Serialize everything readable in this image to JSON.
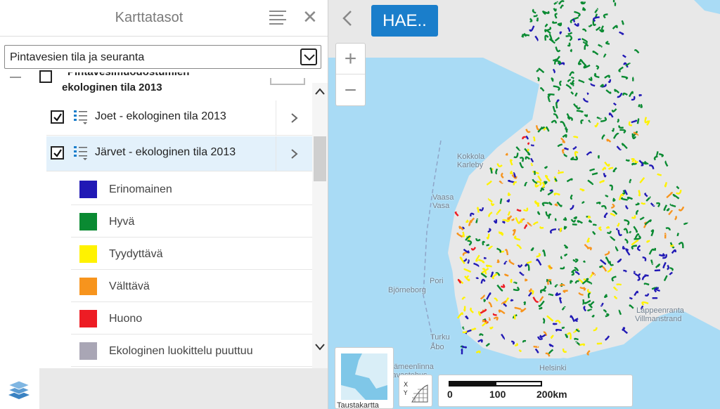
{
  "panel": {
    "title": "Karttatasot",
    "theme_select": "Pintavesien tila ja seuranta",
    "group": {
      "title_line1": "Pintavesimuodostumien",
      "title_line2": "ekologinen tila 2013"
    },
    "layers": [
      {
        "label": "Joet - ekologinen tila 2013",
        "checked": true,
        "selected": false
      },
      {
        "label": "Järvet - ekologinen tila 2013",
        "checked": true,
        "selected": true
      }
    ],
    "legend": [
      {
        "label": "Erinomainen",
        "color": "#2119b5"
      },
      {
        "label": "Hyvä",
        "color": "#0a8a32"
      },
      {
        "label": "Tyydyttävä",
        "color": "#fff200"
      },
      {
        "label": "Välttävä",
        "color": "#f7941d"
      },
      {
        "label": "Huono",
        "color": "#ed1c24"
      },
      {
        "label": "Ekologinen luokittelu puuttuu",
        "color": "#a9a6b5"
      }
    ]
  },
  "map": {
    "search_button": "HAE..",
    "zoom_in": "+",
    "zoom_out": "−",
    "background_label": "Taustakartta",
    "labels": [
      {
        "text": "Kokkola"
      },
      {
        "text": "Karleby"
      },
      {
        "text": "Vaasa"
      },
      {
        "text": "Vasa"
      },
      {
        "text": "Pori"
      },
      {
        "text": "Björneborg"
      },
      {
        "text": "Turku"
      },
      {
        "text": "Åbo"
      },
      {
        "text": "Helsinki"
      },
      {
        "text": "Hämeenlinna"
      },
      {
        "text": "Tavastehus"
      },
      {
        "text": "Lappeenranta"
      },
      {
        "text": "Villmanstrand"
      }
    ],
    "scale": {
      "ticks": [
        "0",
        "100",
        "200km"
      ]
    }
  },
  "colors": {
    "accent": "#1a7ecb",
    "sea": "#a9dbf5",
    "land": "#e8e8e8"
  }
}
